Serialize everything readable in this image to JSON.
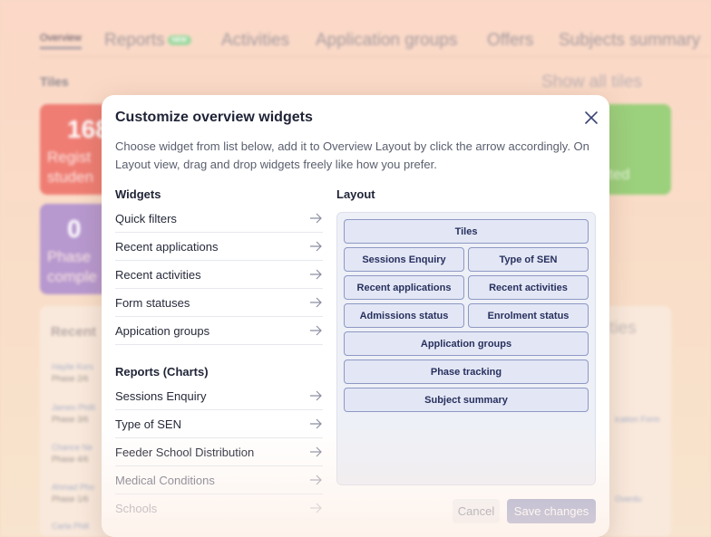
{
  "background": {
    "nav": {
      "tabs": [
        {
          "label": "Overview"
        },
        {
          "label": "Reports",
          "badge": "NEW"
        },
        {
          "label": "Activities"
        },
        {
          "label": "Application groups"
        },
        {
          "label": "Offers"
        },
        {
          "label": "Subjects summary"
        }
      ]
    },
    "tiles_title": "Tiles",
    "show_all": "Show all tiles",
    "tile_red": {
      "number": "168",
      "text_1": "Regist",
      "text_2": "studen"
    },
    "tile_purple": {
      "number": "0",
      "text_1": "Phase",
      "text_2": "comple"
    },
    "tile_green": {
      "text": "ted"
    },
    "recent_title": "Recent",
    "recent_right": "ties",
    "rows": [
      {
        "name": "Haylie Kors",
        "phase": "Phase 2/6"
      },
      {
        "name": "James Philli",
        "phase": "Phase 3/6"
      },
      {
        "name": "Chance Ne",
        "phase": "Phase 4/6"
      },
      {
        "name": "Ahmad Pho",
        "phase": "Phase 1/6"
      },
      {
        "name": "Carla Phill",
        "phase": ""
      }
    ],
    "rows_right": [
      "ication Form",
      "Overdu"
    ]
  },
  "modal": {
    "title": "Customize overview widgets",
    "description": "Choose widget from list below, add it to Overview Layout by click the arrow accordingly. On Layout view, drag and drop widgets freely like how you prefer.",
    "widgets_heading": "Widgets",
    "layout_heading": "Layout",
    "widgets": [
      "Quick filters",
      "Recent applications",
      "Recent activities",
      "Form statuses",
      "Appication groups"
    ],
    "reports_heading": "Reports (Charts)",
    "reports": [
      "Sessions Enquiry",
      "Type of SEN",
      "Feeder School Distribution",
      "Medical Conditions",
      "Schools"
    ],
    "layout_items": {
      "tiles": "Tiles",
      "sessions_enquiry": "Sessions Enquiry",
      "type_of_sen": "Type of SEN",
      "recent_applications": "Recent applications",
      "recent_activities": "Recent activities",
      "admissions_status": "Admissions status",
      "enrolment_status": "Enrolment status",
      "application_groups": "Application groups",
      "phase_tracking": "Phase tracking",
      "subject_summary": "Subject summary"
    },
    "cancel_label": "Cancel",
    "save_label": "Save changes"
  },
  "icons": {
    "arrow": "arrow-right-icon",
    "close": "close-icon"
  },
  "colors": {
    "primary": "#1f2336",
    "chip_border": "#8d98c4",
    "save_disabled": "#a7add0"
  }
}
